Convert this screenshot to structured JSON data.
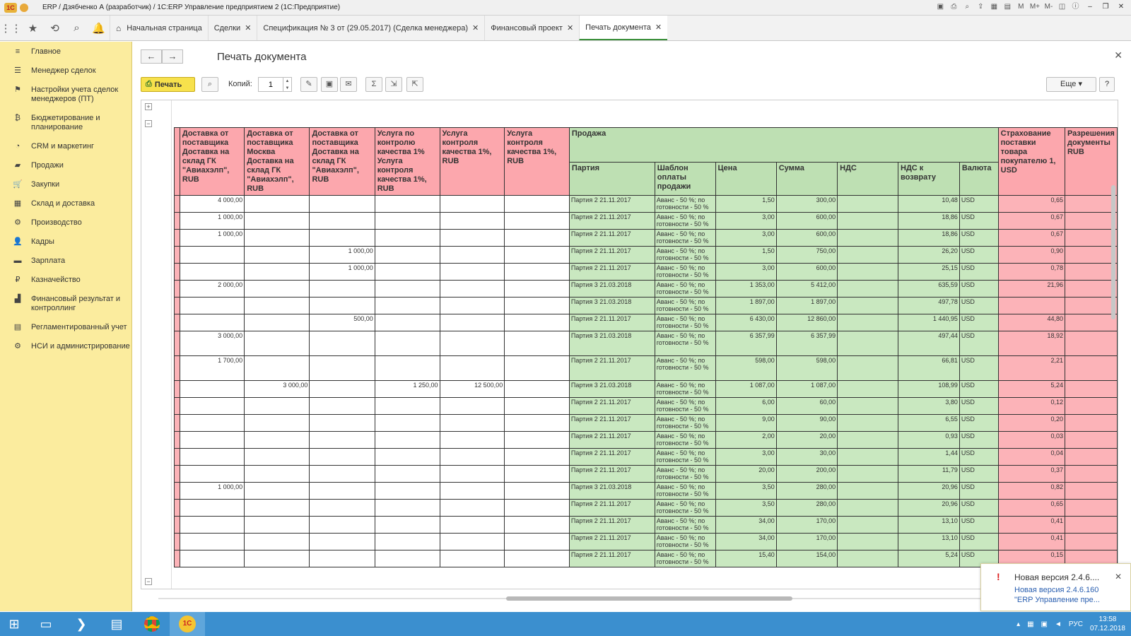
{
  "window": {
    "title": "ERP / Дзябченко А (разработчик) / 1С:ERP Управление предприятием 2  (1С:Предприятие)",
    "controls": [
      "M",
      "M+",
      "M-"
    ]
  },
  "tabs": [
    {
      "label": "Начальная страница"
    },
    {
      "label": "Сделки"
    },
    {
      "label": "Спецификация № 3  от (29.05.2017) (Сделка менеджера)"
    },
    {
      "label": "Финансовый проект"
    },
    {
      "label": "Печать документа"
    }
  ],
  "sidebar": {
    "items": [
      {
        "label": "Главное",
        "icon": "≡"
      },
      {
        "label": "Менеджер сделок",
        "icon": "☰"
      },
      {
        "label": "Настройки учета сделок менеджеров (ПТ)",
        "icon": "⚑"
      },
      {
        "label": "Бюджетирование и планирование",
        "icon": "₿"
      },
      {
        "label": "CRM и маркетинг",
        "icon": "◔"
      },
      {
        "label": "Продажи",
        "icon": "▰"
      },
      {
        "label": "Закупки",
        "icon": "🛒"
      },
      {
        "label": "Склад и доставка",
        "icon": "▦"
      },
      {
        "label": "Производство",
        "icon": "⚙"
      },
      {
        "label": "Кадры",
        "icon": "👤"
      },
      {
        "label": "Зарплата",
        "icon": "▬"
      },
      {
        "label": "Казначейство",
        "icon": "₽"
      },
      {
        "label": "Финансовый результат и контроллинг",
        "icon": "▟"
      },
      {
        "label": "Регламентированный учет",
        "icon": "▤"
      },
      {
        "label": "НСИ и администрирование",
        "icon": "⚙"
      }
    ]
  },
  "form": {
    "title": "Печать документа",
    "print_label": "Печать",
    "copies_label": "Копий:",
    "copies_value": "1",
    "more_label": "Еще",
    "help_label": "?"
  },
  "table": {
    "headers_pink_left": [
      "Доставка от поставщика Доставка на склад ГК \"Авиахэлп\", RUB",
      "Доставка от поставщика Москва Доставка на склад ГК \"Авиахэлп\", RUB",
      "Доставка от поставщика Доставка на склад ГК \"Авиахэлп\", RUB",
      "Услуга по контролю качества 1% Услуга контроля качества 1%, RUB",
      "Услуга контроля качества 1%, RUB",
      "Услуга контроля качества 1%, RUB"
    ],
    "group_sales": "Продажа",
    "headers_green": [
      "Партия",
      "Шаблон оплаты продажи",
      "Цена",
      "Сумма",
      "НДС",
      "НДС к возврату",
      "Валюта"
    ],
    "headers_pink_right": [
      "Страхование поставки товара покупателю 1, USD",
      "Разрешения документы RUB"
    ],
    "payment_template": "Аванс - 50 %; по готовности - 50 %",
    "rows": [
      {
        "c1": "4 000,00",
        "c2": "",
        "c3": "",
        "c4": "",
        "c5": "",
        "party": "Партия 2 21.11.2017",
        "price": "1,50",
        "sum": "300,00",
        "vat_ret": "10,48",
        "cur": "USD",
        "ins": "0,65"
      },
      {
        "c1": "1 000,00",
        "c2": "",
        "c3": "",
        "c4": "",
        "c5": "",
        "party": "Партия 2 21.11.2017",
        "price": "3,00",
        "sum": "600,00",
        "vat_ret": "18,86",
        "cur": "USD",
        "ins": "0,67"
      },
      {
        "c1": "1 000,00",
        "c2": "",
        "c3": "",
        "c4": "",
        "c5": "",
        "party": "Партия 2 21.11.2017",
        "price": "3,00",
        "sum": "600,00",
        "vat_ret": "18,86",
        "cur": "USD",
        "ins": "0,67"
      },
      {
        "c1": "",
        "c2": "",
        "c3": "1 000,00",
        "c4": "",
        "c5": "",
        "party": "Партия 2 21.11.2017",
        "price": "1,50",
        "sum": "750,00",
        "vat_ret": "26,20",
        "cur": "USD",
        "ins": "0,90"
      },
      {
        "c1": "",
        "c2": "",
        "c3": "1 000,00",
        "c4": "",
        "c5": "",
        "party": "Партия 2 21.11.2017",
        "price": "3,00",
        "sum": "600,00",
        "vat_ret": "25,15",
        "cur": "USD",
        "ins": "0,78"
      },
      {
        "c1": "2 000,00",
        "c2": "",
        "c3": "",
        "c4": "",
        "c5": "",
        "party": "Партия 3 21.03.2018",
        "price": "1 353,00",
        "sum": "5 412,00",
        "vat_ret": "635,59",
        "cur": "USD",
        "ins": "21,96"
      },
      {
        "c1": "",
        "c2": "",
        "c3": "",
        "c4": "",
        "c5": "",
        "party": "Партия 3 21.03.2018",
        "price": "1 897,00",
        "sum": "1 897,00",
        "vat_ret": "497,78",
        "cur": "USD",
        "ins": ""
      },
      {
        "c1": "",
        "c2": "",
        "c3": "500,00",
        "c4": "",
        "c5": "",
        "party": "Партия 2 21.11.2017",
        "price": "6 430,00",
        "sum": "12 860,00",
        "vat_ret": "1 440,95",
        "cur": "USD",
        "ins": "44,80"
      },
      {
        "c1": "3 000,00",
        "c2": "",
        "c3": "",
        "c4": "",
        "c5": "",
        "party": "Партия 3 21.03.2018",
        "price": "6 357,99",
        "sum": "6 357,99",
        "vat_ret": "497,44",
        "cur": "USD",
        "ins": "18,92",
        "tall": true
      },
      {
        "c1": "1 700,00",
        "c2": "",
        "c3": "",
        "c4": "",
        "c5": "",
        "party": "Партия 2 21.11.2017",
        "price": "598,00",
        "sum": "598,00",
        "vat_ret": "66,81",
        "cur": "USD",
        "ins": "2,21",
        "tall": true
      },
      {
        "c1": "",
        "c2": "3 000,00",
        "c3": "",
        "c4": "1 250,00",
        "c5": "12 500,00",
        "party": "Партия 3 21.03.2018",
        "price": "1 087,00",
        "sum": "1 087,00",
        "vat_ret": "108,99",
        "cur": "USD",
        "ins": "5,24"
      },
      {
        "c1": "",
        "c2": "",
        "c3": "",
        "c4": "",
        "c5": "",
        "party": "Партия 2 21.11.2017",
        "price": "6,00",
        "sum": "60,00",
        "vat_ret": "3,80",
        "cur": "USD",
        "ins": "0,12"
      },
      {
        "c1": "",
        "c2": "",
        "c3": "",
        "c4": "",
        "c5": "",
        "party": "Партия 2 21.11.2017",
        "price": "9,00",
        "sum": "90,00",
        "vat_ret": "6,55",
        "cur": "USD",
        "ins": "0,20"
      },
      {
        "c1": "",
        "c2": "",
        "c3": "",
        "c4": "",
        "c5": "",
        "party": "Партия 2 21.11.2017",
        "price": "2,00",
        "sum": "20,00",
        "vat_ret": "0,93",
        "cur": "USD",
        "ins": "0,03"
      },
      {
        "c1": "",
        "c2": "",
        "c3": "",
        "c4": "",
        "c5": "",
        "party": "Партия 2 21.11.2017",
        "price": "3,00",
        "sum": "30,00",
        "vat_ret": "1,44",
        "cur": "USD",
        "ins": "0,04"
      },
      {
        "c1": "",
        "c2": "",
        "c3": "",
        "c4": "",
        "c5": "",
        "party": "Партия 2 21.11.2017",
        "price": "20,00",
        "sum": "200,00",
        "vat_ret": "11,79",
        "cur": "USD",
        "ins": "0,37"
      },
      {
        "c1": "1 000,00",
        "c2": "",
        "c3": "",
        "c4": "",
        "c5": "",
        "party": "Партия 3 21.03.2018",
        "price": "3,50",
        "sum": "280,00",
        "vat_ret": "20,96",
        "cur": "USD",
        "ins": "0,82"
      },
      {
        "c1": "",
        "c2": "",
        "c3": "",
        "c4": "",
        "c5": "",
        "party": "Партия 2 21.11.2017",
        "price": "3,50",
        "sum": "280,00",
        "vat_ret": "20,96",
        "cur": "USD",
        "ins": "0,65"
      },
      {
        "c1": "",
        "c2": "",
        "c3": "",
        "c4": "",
        "c5": "",
        "party": "Партия 2 21.11.2017",
        "price": "34,00",
        "sum": "170,00",
        "vat_ret": "13,10",
        "cur": "USD",
        "ins": "0,41"
      },
      {
        "c1": "",
        "c2": "",
        "c3": "",
        "c4": "",
        "c5": "",
        "party": "Партия 2 21.11.2017",
        "price": "34,00",
        "sum": "170,00",
        "vat_ret": "13,10",
        "cur": "USD",
        "ins": "0,41"
      },
      {
        "c1": "",
        "c2": "",
        "c3": "",
        "c4": "",
        "c5": "",
        "party": "Партия 2 21.11.2017",
        "price": "15,40",
        "sum": "154,00",
        "vat_ret": "5,24",
        "cur": "USD",
        "ins": "0,15"
      }
    ]
  },
  "notification": {
    "title": "Новая версия 2.4.6....",
    "line1": "Новая версия 2.4.6.160",
    "line2": "\"ERP Управление пре..."
  },
  "taskbar": {
    "lang": "РУС",
    "time": "13:58",
    "date": "07.12.2018"
  },
  "colors": {
    "sidebar_bg": "#fbec9e",
    "pink": "#fcb3b8",
    "green": "#c9e8c0",
    "print_button": "#f7e14c",
    "taskbar": "#3b8fcf"
  }
}
